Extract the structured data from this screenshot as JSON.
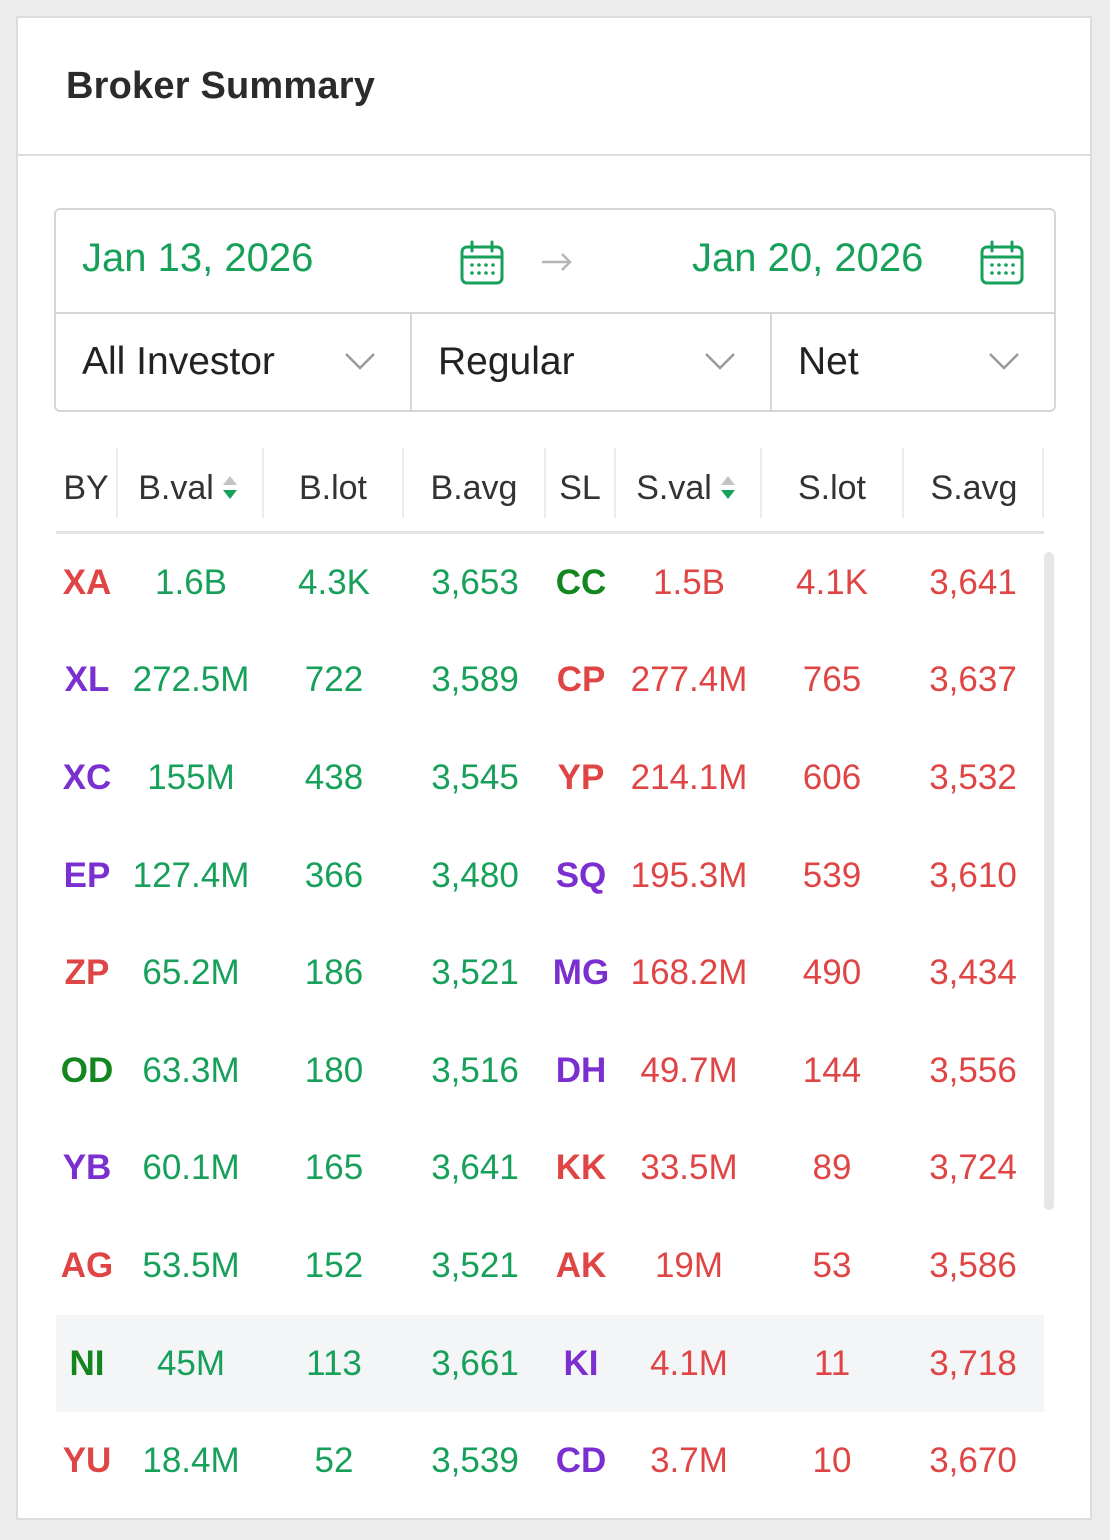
{
  "panel": {
    "title": "Broker Summary"
  },
  "filters": {
    "date_from": "Jan 13, 2026",
    "date_to": "Jan 20, 2026",
    "investor": "All Investor",
    "market": "Regular",
    "mode": "Net"
  },
  "table": {
    "headers": {
      "by": "BY",
      "bval": "B.val",
      "blot": "B.lot",
      "bavg": "B.avg",
      "sl": "SL",
      "sval": "S.val",
      "slot": "S.lot",
      "savg": "S.avg"
    },
    "rows": [
      {
        "by": "XA",
        "by_color": "#e04545",
        "bval": "1.6B",
        "blot": "4.3K",
        "bavg": "3,653",
        "sl": "CC",
        "sl_color": "#13861f",
        "sval": "1.5B",
        "slot": "4.1K",
        "savg": "3,641"
      },
      {
        "by": "XL",
        "by_color": "#7b2fd0",
        "bval": "272.5M",
        "blot": "722",
        "bavg": "3,589",
        "sl": "CP",
        "sl_color": "#e04545",
        "sval": "277.4M",
        "slot": "765",
        "savg": "3,637"
      },
      {
        "by": "XC",
        "by_color": "#7b2fd0",
        "bval": "155M",
        "blot": "438",
        "bavg": "3,545",
        "sl": "YP",
        "sl_color": "#e04545",
        "sval": "214.1M",
        "slot": "606",
        "savg": "3,532"
      },
      {
        "by": "EP",
        "by_color": "#7b2fd0",
        "bval": "127.4M",
        "blot": "366",
        "bavg": "3,480",
        "sl": "SQ",
        "sl_color": "#7b2fd0",
        "sval": "195.3M",
        "slot": "539",
        "savg": "3,610"
      },
      {
        "by": "ZP",
        "by_color": "#e04545",
        "bval": "65.2M",
        "blot": "186",
        "bavg": "3,521",
        "sl": "MG",
        "sl_color": "#7b2fd0",
        "sval": "168.2M",
        "slot": "490",
        "savg": "3,434"
      },
      {
        "by": "OD",
        "by_color": "#13861f",
        "bval": "63.3M",
        "blot": "180",
        "bavg": "3,516",
        "sl": "DH",
        "sl_color": "#7b2fd0",
        "sval": "49.7M",
        "slot": "144",
        "savg": "3,556"
      },
      {
        "by": "YB",
        "by_color": "#7b2fd0",
        "bval": "60.1M",
        "blot": "165",
        "bavg": "3,641",
        "sl": "KK",
        "sl_color": "#e04545",
        "sval": "33.5M",
        "slot": "89",
        "savg": "3,724"
      },
      {
        "by": "AG",
        "by_color": "#e04545",
        "bval": "53.5M",
        "blot": "152",
        "bavg": "3,521",
        "sl": "AK",
        "sl_color": "#e04545",
        "sval": "19M",
        "slot": "53",
        "savg": "3,586"
      },
      {
        "by": "NI",
        "by_color": "#13861f",
        "bval": "45M",
        "blot": "113",
        "bavg": "3,661",
        "sl": "KI",
        "sl_color": "#7b2fd0",
        "sval": "4.1M",
        "slot": "11",
        "savg": "3,718",
        "highlight": true
      },
      {
        "by": "YU",
        "by_color": "#e04545",
        "bval": "18.4M",
        "blot": "52",
        "bavg": "3,539",
        "sl": "CD",
        "sl_color": "#7b2fd0",
        "sval": "3.7M",
        "slot": "10",
        "savg": "3,670"
      }
    ]
  },
  "colors": {
    "buy_green": "#17a05a",
    "sell_red": "#e04545",
    "broker_purple": "#7b2fd0",
    "broker_green": "#13861f",
    "broker_red": "#e04545"
  },
  "icons": [
    "calendar-icon",
    "arrow-right-icon",
    "chevron-down-icon",
    "sort-icon"
  ]
}
